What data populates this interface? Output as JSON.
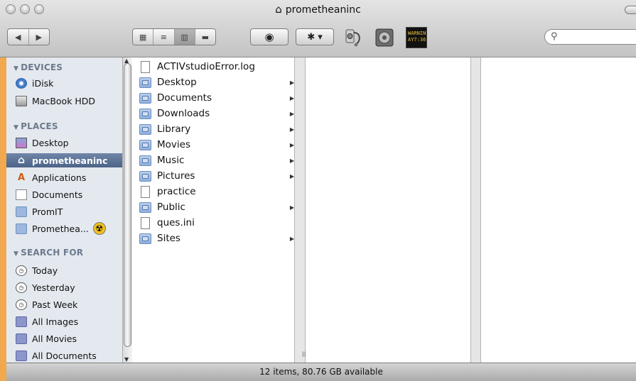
{
  "window": {
    "title": "prometheaninc"
  },
  "toolbar": {
    "back_glyph": "◀",
    "forward_glyph": "▶",
    "view_icons": "▦",
    "view_list": "≡",
    "view_columns": "▥",
    "view_coverflow": "▬",
    "quicklook_glyph": "◉",
    "action_glyph": "✱ ▾",
    "search": {
      "value": "",
      "placeholder": ""
    },
    "widget_warning_text": "WARNIN",
    "widget_warning_sub": "AY7:36"
  },
  "sidebar": {
    "sections": {
      "devices": "DEVICES",
      "places": "PLACES",
      "search_for": "SEARCH FOR"
    },
    "devices": [
      {
        "label": "iDisk",
        "icon": "idisk-icon"
      },
      {
        "label": "MacBook HDD",
        "icon": "hard-drive-icon"
      }
    ],
    "places": [
      {
        "label": "Desktop",
        "icon": "desktop-icon"
      },
      {
        "label": "prometheaninc",
        "icon": "home-icon",
        "selected": true
      },
      {
        "label": "Applications",
        "icon": "applications-icon"
      },
      {
        "label": "Documents",
        "icon": "documents-icon"
      },
      {
        "label": "PromIT",
        "icon": "folder-icon"
      },
      {
        "label": "Promethea...",
        "icon": "network-folder-icon"
      }
    ],
    "search_for": [
      {
        "label": "Today",
        "icon": "clock-icon"
      },
      {
        "label": "Yesterday",
        "icon": "clock-icon"
      },
      {
        "label": "Past Week",
        "icon": "clock-icon"
      },
      {
        "label": "All Images",
        "icon": "smart-folder-icon"
      },
      {
        "label": "All Movies",
        "icon": "smart-folder-icon"
      },
      {
        "label": "All Documents",
        "icon": "smart-folder-icon"
      }
    ]
  },
  "files": [
    {
      "name": "ACTIVstudioError.log",
      "kind": "doc",
      "has_children": false
    },
    {
      "name": "Desktop",
      "kind": "folder",
      "has_children": true
    },
    {
      "name": "Documents",
      "kind": "folder",
      "has_children": true
    },
    {
      "name": "Downloads",
      "kind": "folder",
      "has_children": true
    },
    {
      "name": "Library",
      "kind": "folder",
      "has_children": true
    },
    {
      "name": "Movies",
      "kind": "folder",
      "has_children": true
    },
    {
      "name": "Music",
      "kind": "folder",
      "has_children": true
    },
    {
      "name": "Pictures",
      "kind": "folder",
      "has_children": true
    },
    {
      "name": "practice",
      "kind": "doc",
      "has_children": false
    },
    {
      "name": "Public",
      "kind": "folder",
      "has_children": true
    },
    {
      "name": "ques.ini",
      "kind": "doc",
      "has_children": false
    },
    {
      "name": "Sites",
      "kind": "folder",
      "has_children": true
    }
  ],
  "status": {
    "text": "12 items, 80.76 GB available"
  },
  "colors": {
    "selection": "#5a7096",
    "sidebar_bg": "#e4e9ef",
    "desktop_bg": "#f0a94e"
  }
}
